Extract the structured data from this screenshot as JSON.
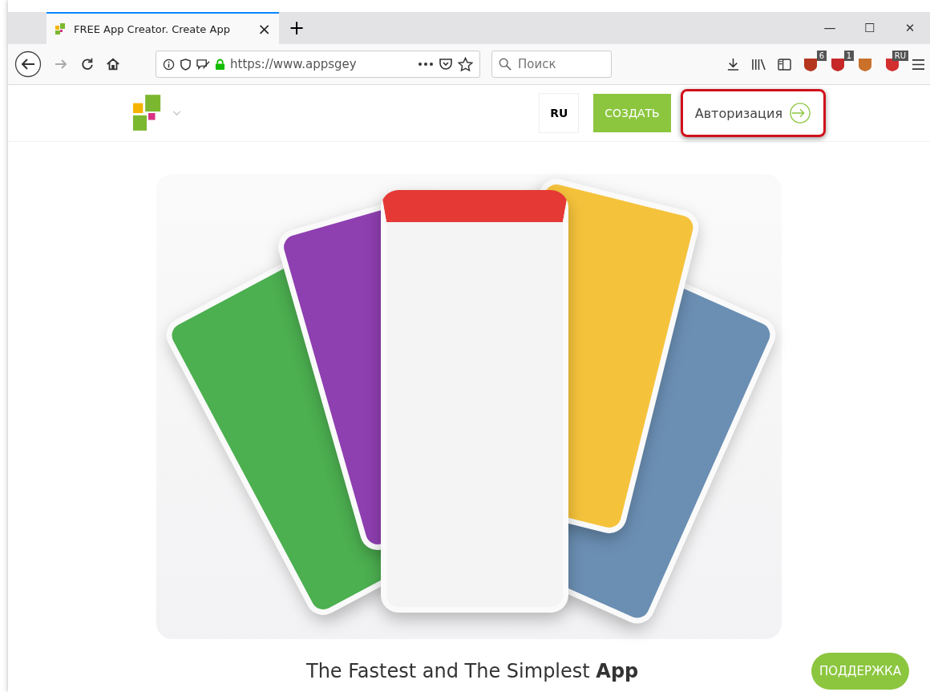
{
  "tab": {
    "title": "FREE App Creator. Create App",
    "close": "×",
    "selected": true
  },
  "new_tab": "+",
  "window_controls": {
    "minimize": "—",
    "maximize": "☐",
    "close": "✕"
  },
  "address_bar": {
    "url": "https://www.appsgey",
    "secure": true
  },
  "search": {
    "placeholder": "Поиск"
  },
  "extensions": [
    {
      "badge": "6",
      "color": "#b5361f"
    },
    {
      "badge": "1",
      "color": "#c62828"
    },
    {
      "color": "#c9702a"
    },
    {
      "badge": "RU",
      "color": "#d32f2f"
    }
  ],
  "page": {
    "language": "RU",
    "create_button": "СОЗДАТЬ",
    "login_button": "Авторизация",
    "login_highlighted": true,
    "headline": "The Fastest and The Simplest **App**",
    "support_button": "ПОДДЕРЖКА"
  }
}
